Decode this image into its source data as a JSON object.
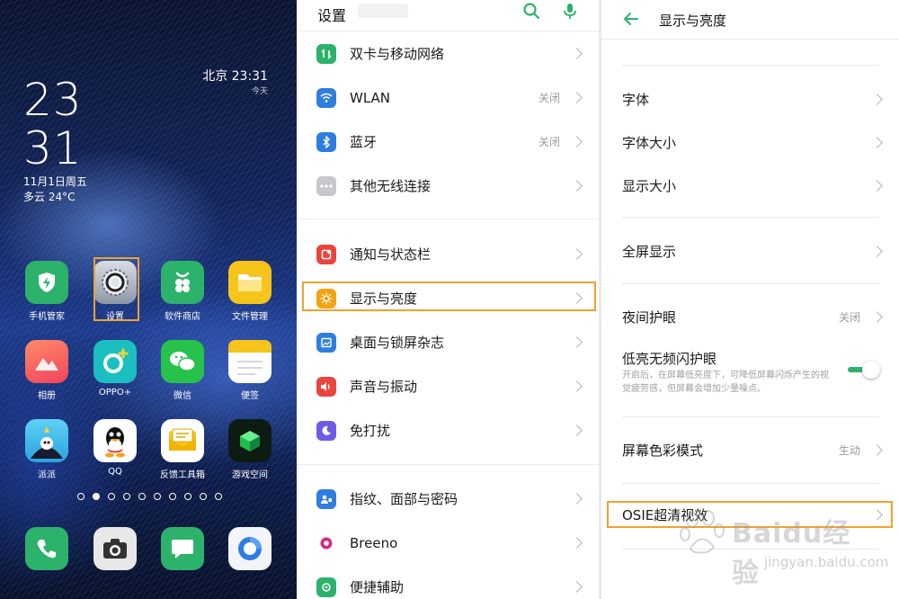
{
  "home": {
    "clock_hour": "23",
    "clock_minute": "31",
    "date": "11月1日周五",
    "weather": "多云 24°C",
    "city_clock": "北京  23:31",
    "city_today": "今天",
    "apps_row1": [
      "手机管家",
      "设置",
      "软件商店",
      "文件管理"
    ],
    "apps_row2": [
      "相册",
      "OPPO+",
      "微信",
      "便签"
    ],
    "apps_row3": [
      "派派",
      "QQ",
      "反馈工具箱",
      "游戏空间"
    ],
    "page_dots_total": 10,
    "page_dots_active": 2,
    "highlight_color": "#f0a22e"
  },
  "settings": {
    "title": "设置",
    "items": [
      {
        "label": "双卡与移动网络",
        "value": "",
        "icon": "dual-sim-icon",
        "color": "#2db26c"
      },
      {
        "label": "WLAN",
        "value": "关闭",
        "icon": "wifi-icon",
        "color": "#2f7de1"
      },
      {
        "label": "蓝牙",
        "value": "关闭",
        "icon": "bluetooth-icon",
        "color": "#2f7de1"
      },
      {
        "label": "其他无线连接",
        "value": "",
        "icon": "more-connections-icon",
        "color": "#c7c7cc"
      },
      {
        "label": "通知与状态栏",
        "value": "",
        "icon": "notification-icon",
        "color": "#e9453f"
      },
      {
        "label": "显示与亮度",
        "value": "",
        "icon": "brightness-icon",
        "color": "#f2a314"
      },
      {
        "label": "桌面与锁屏杂志",
        "value": "",
        "icon": "wallpaper-icon",
        "color": "#2f7de1"
      },
      {
        "label": "声音与振动",
        "value": "",
        "icon": "sound-icon",
        "color": "#e9453f"
      },
      {
        "label": "免打扰",
        "value": "",
        "icon": "moon-icon",
        "color": "#6b5ce7"
      },
      {
        "label": "指纹、面部与密码",
        "value": "",
        "icon": "fingerprint-icon",
        "color": "#2f7de1"
      },
      {
        "label": "Breeno",
        "value": "",
        "icon": "breeno-icon",
        "color": "#d12b8a"
      },
      {
        "label": "便捷辅助",
        "value": "",
        "icon": "assist-icon",
        "color": "#2db26c"
      }
    ]
  },
  "display": {
    "title": "显示与亮度",
    "font": "字体",
    "font_size": "字体大小",
    "display_size": "显示大小",
    "fullscreen": "全屏显示",
    "night_mode": "夜间护眼",
    "night_mode_value": "关闭",
    "low_flicker": "低亮无频闪护眼",
    "low_flicker_desc": "开启后，在屏幕低亮度下，可降低屏幕闪烁产生的视觉疲劳感，但屏幕会增加少量噪点。",
    "low_flicker_on": true,
    "color_mode": "屏幕色彩模式",
    "color_mode_value": "生动",
    "osie": "OSIE超清视效"
  },
  "watermark": {
    "text": "Baidu经验",
    "sub": "jingyan.baidu.com"
  },
  "colors": {
    "accent_green": "#2db26c",
    "highlight": "#f0a22e"
  }
}
